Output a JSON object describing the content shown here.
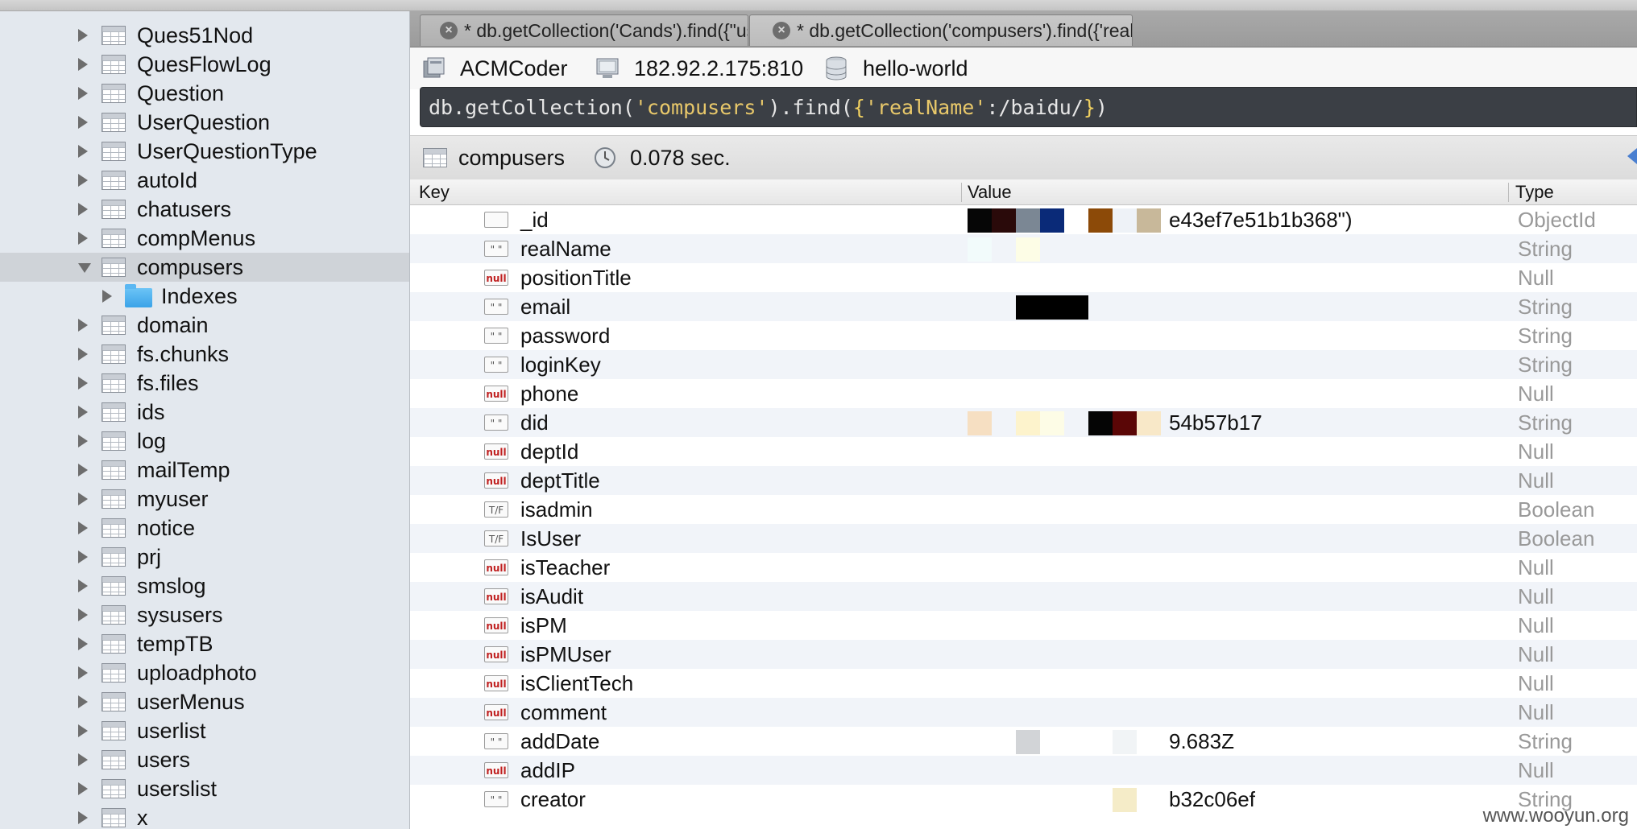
{
  "sidebar": {
    "items": [
      {
        "label": "Ques51Nod",
        "expanded": false,
        "selected": false,
        "kind": "collection"
      },
      {
        "label": "QuesFlowLog",
        "expanded": false,
        "selected": false,
        "kind": "collection"
      },
      {
        "label": "Question",
        "expanded": false,
        "selected": false,
        "kind": "collection"
      },
      {
        "label": "UserQuestion",
        "expanded": false,
        "selected": false,
        "kind": "collection"
      },
      {
        "label": "UserQuestionType",
        "expanded": false,
        "selected": false,
        "kind": "collection"
      },
      {
        "label": "autoId",
        "expanded": false,
        "selected": false,
        "kind": "collection"
      },
      {
        "label": "chatusers",
        "expanded": false,
        "selected": false,
        "kind": "collection"
      },
      {
        "label": "compMenus",
        "expanded": false,
        "selected": false,
        "kind": "collection"
      },
      {
        "label": "compusers",
        "expanded": true,
        "selected": true,
        "kind": "collection"
      },
      {
        "label": "Indexes",
        "expanded": false,
        "selected": false,
        "kind": "folder"
      },
      {
        "label": "domain",
        "expanded": false,
        "selected": false,
        "kind": "collection"
      },
      {
        "label": "fs.chunks",
        "expanded": false,
        "selected": false,
        "kind": "collection"
      },
      {
        "label": "fs.files",
        "expanded": false,
        "selected": false,
        "kind": "collection"
      },
      {
        "label": "ids",
        "expanded": false,
        "selected": false,
        "kind": "collection"
      },
      {
        "label": "log",
        "expanded": false,
        "selected": false,
        "kind": "collection"
      },
      {
        "label": "mailTemp",
        "expanded": false,
        "selected": false,
        "kind": "collection"
      },
      {
        "label": "myuser",
        "expanded": false,
        "selected": false,
        "kind": "collection"
      },
      {
        "label": "notice",
        "expanded": false,
        "selected": false,
        "kind": "collection"
      },
      {
        "label": "prj",
        "expanded": false,
        "selected": false,
        "kind": "collection"
      },
      {
        "label": "smslog",
        "expanded": false,
        "selected": false,
        "kind": "collection"
      },
      {
        "label": "sysusers",
        "expanded": false,
        "selected": false,
        "kind": "collection"
      },
      {
        "label": "tempTB",
        "expanded": false,
        "selected": false,
        "kind": "collection"
      },
      {
        "label": "uploadphoto",
        "expanded": false,
        "selected": false,
        "kind": "collection"
      },
      {
        "label": "userMenus",
        "expanded": false,
        "selected": false,
        "kind": "collection"
      },
      {
        "label": "userlist",
        "expanded": false,
        "selected": false,
        "kind": "collection"
      },
      {
        "label": "users",
        "expanded": false,
        "selected": false,
        "kind": "collection"
      },
      {
        "label": "userslist",
        "expanded": false,
        "selected": false,
        "kind": "collection"
      },
      {
        "label": "x",
        "expanded": false,
        "selected": false,
        "kind": "collection"
      }
    ]
  },
  "tabs": [
    {
      "label": "* db.getCollection('Cands').find({\"userName",
      "active": false
    },
    {
      "label": "* db.getCollection('compusers').find({'real",
      "active": true
    }
  ],
  "connection": {
    "server": "ACMCoder",
    "host": "182.92.2.175:810",
    "database": "hello-world"
  },
  "query": {
    "prefix": "db.getCollection(",
    "collection_arg": "'compusers'",
    "mid": ").find(",
    "brace_open": "{",
    "key_arg": "'realName'",
    "regex": ":/baidu/",
    "brace_close": "}",
    "suffix": ")"
  },
  "result": {
    "collection": "compusers",
    "time": "0.078 sec."
  },
  "columns": {
    "key": "Key",
    "value": "Value",
    "type": "Type"
  },
  "rows": [
    {
      "key": "_id",
      "badge": "",
      "value": "e43ef7e51b1b368\")",
      "type": "ObjectId"
    },
    {
      "key": "realName",
      "badge": "\" \"",
      "value": "",
      "type": "String"
    },
    {
      "key": "positionTitle",
      "badge": "null",
      "value": "",
      "type": "Null"
    },
    {
      "key": "email",
      "badge": "\" \"",
      "value": "",
      "type": "String"
    },
    {
      "key": "password",
      "badge": "\" \"",
      "value": "",
      "type": "String"
    },
    {
      "key": "loginKey",
      "badge": "\" \"",
      "value": "",
      "type": "String"
    },
    {
      "key": "phone",
      "badge": "null",
      "value": "",
      "type": "Null"
    },
    {
      "key": "did",
      "badge": "\" \"",
      "value": "54b57b17",
      "type": "String"
    },
    {
      "key": "deptId",
      "badge": "null",
      "value": "",
      "type": "Null"
    },
    {
      "key": "deptTitle",
      "badge": "null",
      "value": "",
      "type": "Null"
    },
    {
      "key": "isadmin",
      "badge": "T/F",
      "value": "",
      "type": "Boolean"
    },
    {
      "key": "IsUser",
      "badge": "T/F",
      "value": "",
      "type": "Boolean"
    },
    {
      "key": "isTeacher",
      "badge": "null",
      "value": "",
      "type": "Null"
    },
    {
      "key": "isAudit",
      "badge": "null",
      "value": "",
      "type": "Null"
    },
    {
      "key": "isPM",
      "badge": "null",
      "value": "",
      "type": "Null"
    },
    {
      "key": "isPMUser",
      "badge": "null",
      "value": "",
      "type": "Null"
    },
    {
      "key": "isClientTech",
      "badge": "null",
      "value": "",
      "type": "Null"
    },
    {
      "key": "comment",
      "badge": "null",
      "value": "",
      "type": "Null"
    },
    {
      "key": "addDate",
      "badge": "\" \"",
      "value": "9.683Z",
      "type": "String"
    },
    {
      "key": "addIP",
      "badge": "null",
      "value": "",
      "type": "Null"
    },
    {
      "key": "creator",
      "badge": "\" \"",
      "value": "b32c06ef",
      "type": "String"
    }
  ],
  "watermark": "www.wooyun.org",
  "colors": {
    "sidebar_bg": "#e3e8ee",
    "selected_bg": "#cfd3d8",
    "row_alt_bg": "#f1f4f9",
    "query_bg": "#3b3f45",
    "query_string": "#e8c86a",
    "type_text": "#999999",
    "null_badge": "#c02020"
  },
  "icons": {
    "collection": "table-icon",
    "folder": "folder-icon",
    "server": "server-icon",
    "host": "monitor-icon",
    "database": "database-icon",
    "time": "clock-icon",
    "tab_close": "close-icon"
  }
}
